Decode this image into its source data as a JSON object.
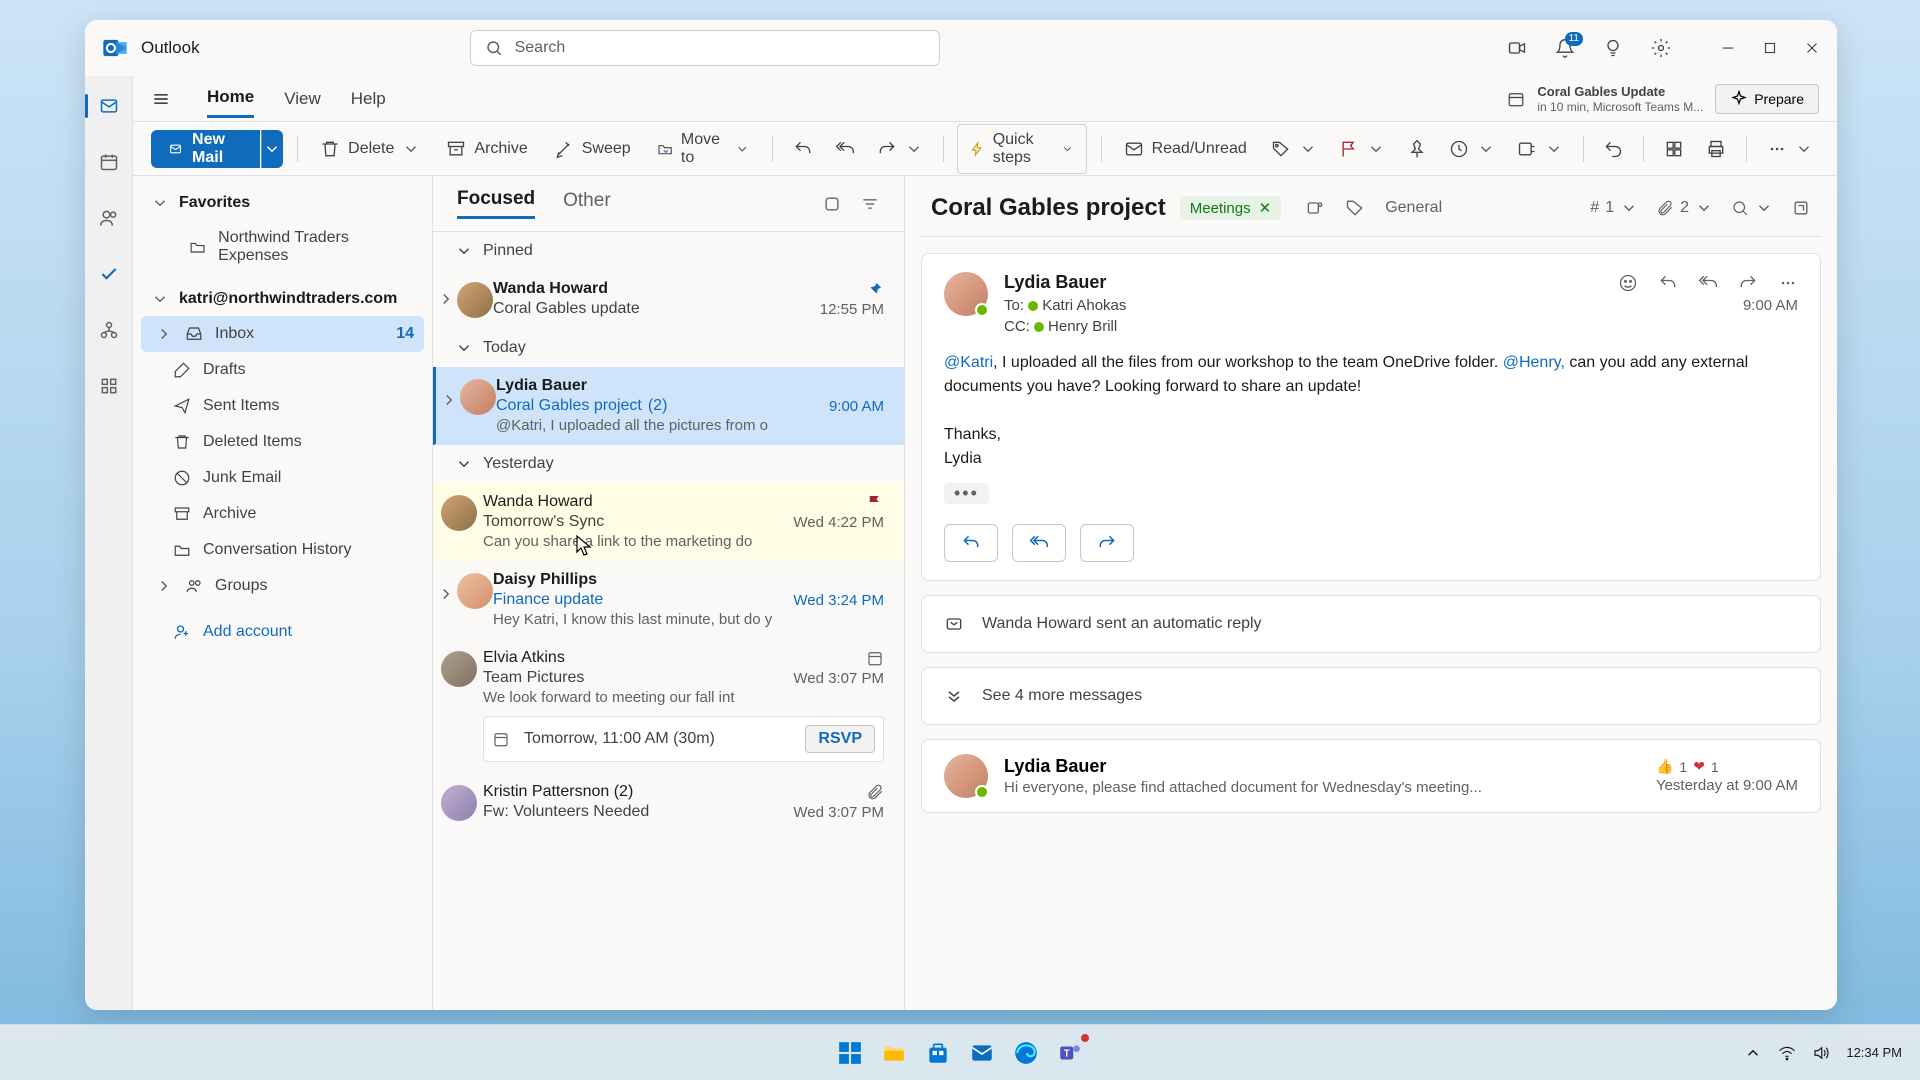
{
  "app": {
    "name": "Outlook"
  },
  "search": {
    "placeholder": "Search"
  },
  "notifications": {
    "badge": "11"
  },
  "meeting_reminder": {
    "title": "Coral Gables Update",
    "sub": "in 10 min, Microsoft Teams M...",
    "prepare": "Prepare"
  },
  "tabs": {
    "home": "Home",
    "view": "View",
    "help": "Help"
  },
  "toolbar": {
    "new_mail": "New Mail",
    "delete": "Delete",
    "archive": "Archive",
    "sweep": "Sweep",
    "move_to": "Move to",
    "quick_steps": "Quick steps",
    "read_unread": "Read/Unread"
  },
  "folders": {
    "favorites": "Favorites",
    "northwind_expenses": "Northwind Traders Expenses",
    "account": "katri@northwindtraders.com",
    "inbox": "Inbox",
    "inbox_count": "14",
    "drafts": "Drafts",
    "sent": "Sent Items",
    "deleted": "Deleted Items",
    "junk": "Junk Email",
    "archive": "Archive",
    "conv_history": "Conversation History",
    "groups": "Groups",
    "add_account": "Add account"
  },
  "msglist": {
    "focused": "Focused",
    "other": "Other",
    "groups": {
      "pinned": "Pinned",
      "today": "Today",
      "yesterday": "Yesterday"
    },
    "items": [
      {
        "sender": "Wanda Howard",
        "subject": "Coral Gables update",
        "time": "12:55 PM"
      },
      {
        "sender": "Lydia Bauer",
        "subject": "Coral Gables project",
        "count": "(2)",
        "time": "9:00 AM",
        "preview": "@Katri, I uploaded all the pictures from o"
      },
      {
        "sender": "Wanda Howard",
        "subject": "Tomorrow's Sync",
        "time": "Wed 4:22 PM",
        "preview": "Can you share a link to the marketing do"
      },
      {
        "sender": "Daisy Phillips",
        "subject": "Finance update",
        "time": "Wed 3:24 PM",
        "preview": "Hey Katri, I know this last minute, but do y"
      },
      {
        "sender": "Elvia Atkins",
        "subject": "Team Pictures",
        "time": "Wed 3:07 PM",
        "preview": "We look forward to meeting our fall int",
        "rsvp_time": "Tomorrow, 11:00 AM (30m)",
        "rsvp": "RSVP"
      },
      {
        "sender": "Kristin Pattersnon (2)",
        "subject": "Fw: Volunteers Needed",
        "time": "Wed 3:07 PM"
      }
    ]
  },
  "reading": {
    "subject": "Coral Gables project",
    "tag": "Meetings",
    "category": "General",
    "thread_count": "1",
    "attach_count": "2",
    "from": "Lydia Bauer",
    "to_label": "To:",
    "to_name": "Katri Ahokas",
    "cc_label": "CC:",
    "cc_name": "Henry Brill",
    "timestamp": "9:00 AM",
    "body_mention1": "@Katri",
    "body_text1": ", I uploaded all the files from our workshop to the team OneDrive folder. ",
    "body_mention2": "@Henry,",
    "body_text2": " can you add any external documents you have? Looking forward to share an update!",
    "thanks": "Thanks,",
    "sig": "Lydia",
    "auto_reply": "Wanda Howard sent an automatic reply",
    "see_more": "See 4 more messages",
    "collapsed_from": "Lydia Bauer",
    "collapsed_preview": "Hi everyone, please find attached document for Wednesday's meeting...",
    "collapsed_ts": "Yesterday at 9:00 AM",
    "react_thumbs": "1",
    "react_heart": "1"
  },
  "taskbar": {
    "time": "12:34 PM"
  }
}
